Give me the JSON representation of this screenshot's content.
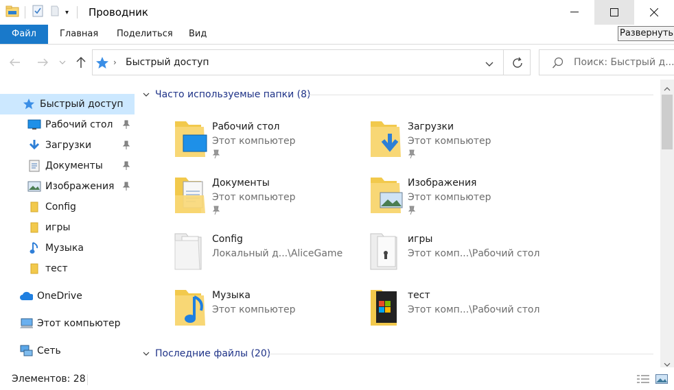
{
  "window": {
    "title": "Проводник",
    "tooltip": "Развернуть"
  },
  "ribbon": {
    "tabs": [
      "Файл",
      "Главная",
      "Поделиться",
      "Вид"
    ]
  },
  "address": {
    "path": "Быстрый доступ",
    "search_placeholder": "Поиск: Быстрый д..."
  },
  "nav": {
    "items": [
      {
        "label": "Быстрый доступ",
        "icon": "star-icon",
        "selected": true,
        "pinned": false
      },
      {
        "label": "Рабочий стол",
        "icon": "desktop-icon",
        "pinned": true
      },
      {
        "label": "Загрузки",
        "icon": "download-icon",
        "pinned": true
      },
      {
        "label": "Документы",
        "icon": "document-icon",
        "pinned": true
      },
      {
        "label": "Изображения",
        "icon": "pictures-icon",
        "pinned": true
      },
      {
        "label": "Config",
        "icon": "folder-icon",
        "pinned": false
      },
      {
        "label": "игры",
        "icon": "folder-icon",
        "pinned": false
      },
      {
        "label": "Музыка",
        "icon": "music-icon",
        "pinned": false
      },
      {
        "label": "тест",
        "icon": "folder-icon",
        "pinned": false
      },
      {
        "label": "OneDrive",
        "icon": "cloud-icon",
        "pinned": false
      },
      {
        "label": "Этот компьютер",
        "icon": "computer-icon",
        "pinned": false
      },
      {
        "label": "Сеть",
        "icon": "network-icon",
        "pinned": false
      }
    ]
  },
  "content": {
    "frequent_header": "Часто используемые папки (8)",
    "recent_header": "Последние файлы (20)",
    "folders": [
      {
        "name": "Рабочий стол",
        "sub": "Этот компьютер",
        "pinned": true,
        "icon": "desktop-folder-icon"
      },
      {
        "name": "Загрузки",
        "sub": "Этот компьютер",
        "pinned": true,
        "icon": "downloads-folder-icon"
      },
      {
        "name": "Документы",
        "sub": "Этот компьютер",
        "pinned": true,
        "icon": "documents-folder-icon"
      },
      {
        "name": "Изображения",
        "sub": "Этот компьютер",
        "pinned": true,
        "icon": "pictures-folder-icon"
      },
      {
        "name": "Config",
        "sub": "Локальный д...\\AliceGame",
        "pinned": false,
        "icon": "config-folder-icon"
      },
      {
        "name": "игры",
        "sub": "Этот комп...\\Рабочий стол",
        "pinned": false,
        "icon": "games-folder-icon"
      },
      {
        "name": "Музыка",
        "sub": "Этот компьютер",
        "pinned": false,
        "icon": "music-folder-icon"
      },
      {
        "name": "тест",
        "sub": "Этот комп...\\Рабочий стол",
        "pinned": false,
        "icon": "test-folder-icon"
      }
    ]
  },
  "status": {
    "items_count": "Элементов: 28"
  },
  "colors": {
    "accent": "#1979ca",
    "selection": "#cce8ff",
    "group_header": "#1e3287",
    "folder": "#f8d775"
  }
}
